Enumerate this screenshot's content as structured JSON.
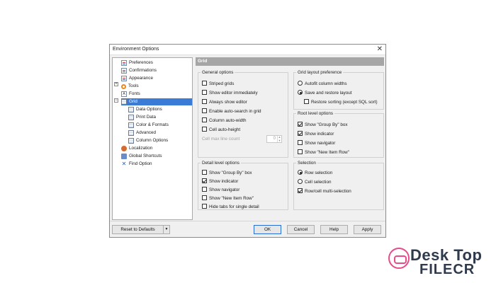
{
  "window": {
    "title": "Environment Options",
    "close_glyph": "✕"
  },
  "tree": {
    "items": [
      {
        "label": "Preferences",
        "icon": "document-icon"
      },
      {
        "label": "Confirmations",
        "icon": "document-icon"
      },
      {
        "label": "Appearance",
        "icon": "document-icon"
      },
      {
        "label": "Tools",
        "icon": "gear-icon",
        "expander": "+"
      },
      {
        "label": "Fonts",
        "icon": "font-icon"
      },
      {
        "label": "Grid",
        "icon": "grid-icon",
        "expander": "−",
        "selected": true
      },
      {
        "label": "Data Options",
        "icon": "grid-icon"
      },
      {
        "label": "Print Data",
        "icon": "grid-icon"
      },
      {
        "label": "Color & Formats",
        "icon": "grid-icon"
      },
      {
        "label": "Advanced",
        "icon": "grid-icon"
      },
      {
        "label": "Column Options",
        "icon": "grid-icon"
      },
      {
        "label": "Localization",
        "icon": "globe-icon"
      },
      {
        "label": "Global Shortcuts",
        "icon": "key-icon"
      },
      {
        "label": "Find Option",
        "icon": "find-icon"
      }
    ]
  },
  "panel": {
    "header": "Grid",
    "general": {
      "legend": "General options",
      "options": [
        {
          "label": "Striped grids",
          "checked": false
        },
        {
          "label": "Show editor immediately",
          "checked": false
        },
        {
          "label": "Always show editor",
          "checked": false
        },
        {
          "label": "Enable auto-search in grid",
          "checked": false
        },
        {
          "label": "Column auto-width",
          "checked": false
        },
        {
          "label": "Cell auto-height",
          "checked": false
        }
      ],
      "cell_max_line_label": "Cell max line count",
      "cell_max_line_value": "0"
    },
    "layout": {
      "legend": "Grid layout preference",
      "options": [
        {
          "label": "Autofit column widths",
          "type": "radio",
          "checked": false
        },
        {
          "label": "Save and restore layout",
          "type": "radio",
          "checked": true
        },
        {
          "label": "Restore sorting (except SQL sort)",
          "type": "check",
          "checked": false
        }
      ]
    },
    "root": {
      "legend": "Root level options",
      "options": [
        {
          "label": "Show \"Group By\" box",
          "checked": true
        },
        {
          "label": "Show indicator",
          "checked": true
        },
        {
          "label": "Show navigator",
          "checked": false
        },
        {
          "label": "Show \"New Item Row\"",
          "checked": false
        }
      ]
    },
    "detail": {
      "legend": "Detail level options",
      "options": [
        {
          "label": "Show \"Group By\" box",
          "checked": false
        },
        {
          "label": "Show indicator",
          "checked": true
        },
        {
          "label": "Show navigator",
          "checked": false
        },
        {
          "label": "Show \"New Item Row\"",
          "checked": false
        },
        {
          "label": "Hide tabs for single detail",
          "checked": false
        }
      ]
    },
    "selection": {
      "legend": "Selection",
      "options": [
        {
          "label": "Row selection",
          "type": "radio",
          "checked": true
        },
        {
          "label": "Cell selection",
          "type": "radio",
          "checked": false
        },
        {
          "label": "Row/cell multi-selection",
          "type": "check",
          "checked": true
        }
      ]
    }
  },
  "buttons": {
    "reset": "Reset to Defaults",
    "dropdown_glyph": "▼",
    "ok": "OK",
    "cancel": "Cancel",
    "help": "Help",
    "apply": "Apply"
  },
  "watermark": {
    "line1": "Desk Top",
    "line2": "FILECR"
  }
}
